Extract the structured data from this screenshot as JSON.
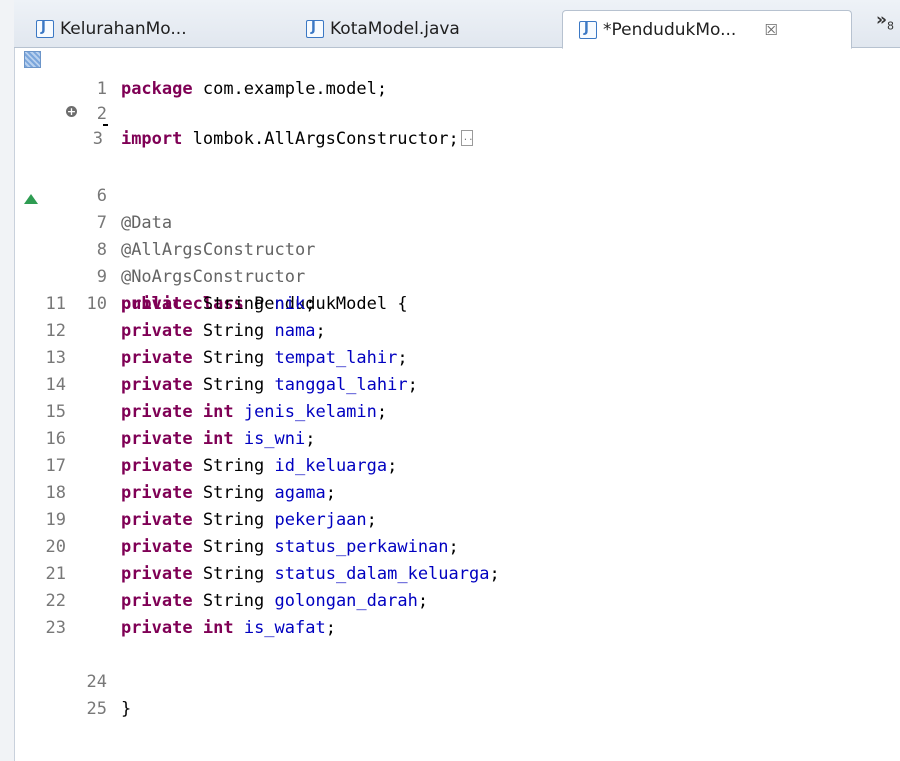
{
  "tabs": [
    {
      "label": "KelurahanMo...",
      "active": false
    },
    {
      "label": "KotaModel.java",
      "active": false
    },
    {
      "label": "*PendudukMo...",
      "active": true
    }
  ],
  "tab_close_glyph": "☒",
  "overflow": {
    "glyph": "»",
    "count": "8"
  },
  "code": {
    "l1": {
      "num": "1",
      "kw": "package",
      "rest": " com.example.model;"
    },
    "l2": {
      "num": "2"
    },
    "l3": {
      "num": "3",
      "kw": "import",
      "rest": " lombok.AllArgsConstructor;"
    },
    "l6": {
      "num": "6"
    },
    "l7": {
      "num": "7",
      "ann": "@Data"
    },
    "l8": {
      "num": "8",
      "ann": "@AllArgsConstructor"
    },
    "l9": {
      "num": "9",
      "ann": "@NoArgsConstructor"
    },
    "l10": {
      "num": "10",
      "kw1": "public",
      "kw2": "class",
      "rest": " PendudukModel {"
    },
    "fields": [
      {
        "num": "11",
        "type": "String",
        "name": "nik"
      },
      {
        "num": "12",
        "type": "String",
        "name": "nama"
      },
      {
        "num": "13",
        "type": "String",
        "name": "tempat_lahir"
      },
      {
        "num": "14",
        "type": "String",
        "name": "tanggal_lahir"
      },
      {
        "num": "15",
        "type": "int",
        "name": "jenis_kelamin"
      },
      {
        "num": "16",
        "type": "int",
        "name": "is_wni"
      },
      {
        "num": "17",
        "type": "String",
        "name": "id_keluarga"
      },
      {
        "num": "18",
        "type": "String",
        "name": "agama"
      },
      {
        "num": "19",
        "type": "String",
        "name": "pekerjaan"
      },
      {
        "num": "20",
        "type": "String",
        "name": "status_perkawinan"
      },
      {
        "num": "21",
        "type": "String",
        "name": "status_dalam_keluarga"
      },
      {
        "num": "22",
        "type": "String",
        "name": "golongan_darah"
      },
      {
        "num": "23",
        "type": "int",
        "name": "is_wafat"
      }
    ],
    "l24": {
      "num": "24"
    },
    "l25": {
      "num": "25",
      "rest": "}"
    }
  },
  "colors": {
    "keyword": "#7f0055",
    "annotation": "#646464",
    "field": "#0000c0",
    "line_number": "#787878"
  }
}
